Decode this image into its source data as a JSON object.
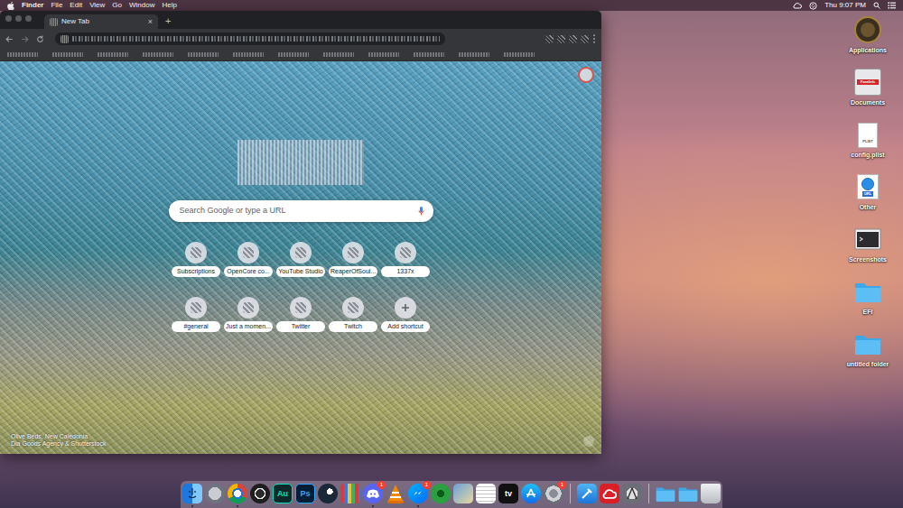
{
  "menu_bar": {
    "app_name": "Finder",
    "menus": [
      "File",
      "Edit",
      "View",
      "Go",
      "Window",
      "Help"
    ],
    "clock": "Thu 9:07 PM"
  },
  "browser": {
    "tabs": [
      {
        "label": "New Tab",
        "selected": true
      }
    ],
    "close_tab": "×",
    "new_tab": "+",
    "search": {
      "placeholder": "Search Google or type a URL"
    },
    "shortcuts": [
      {
        "label": "Subscriptions",
        "kind": "site"
      },
      {
        "label": "OpenCore co...",
        "kind": "site"
      },
      {
        "label": "YouTube Studio",
        "kind": "site"
      },
      {
        "label": "ReaperOfSoul...",
        "kind": "site"
      },
      {
        "label": "1337x",
        "kind": "site"
      },
      {
        "label": "#general",
        "kind": "site"
      },
      {
        "label": "Just a momen...",
        "kind": "site"
      },
      {
        "label": "Twitter",
        "kind": "site"
      },
      {
        "label": "Twitch",
        "kind": "site"
      },
      {
        "label": "Add shortcut",
        "kind": "add"
      }
    ],
    "credit": [
      "Olive Beds, New Caledonia",
      "Dia Goods Agency & Shutterstock"
    ]
  },
  "desktop_icons": [
    {
      "label": "Applications",
      "kind": "disk"
    },
    {
      "label": "Documents",
      "kind": "parallels",
      "glyph": "Parallels"
    },
    {
      "label": "config.plist",
      "kind": "document",
      "glyph": "PLIST"
    },
    {
      "label": "Other",
      "kind": "urldoc",
      "glyph": "URL"
    },
    {
      "label": "Screenshots",
      "kind": "screenshot"
    },
    {
      "label": "EFI",
      "kind": "folder"
    },
    {
      "label": "untitled folder",
      "kind": "folder"
    }
  ],
  "dock": [
    {
      "items": [
        {
          "kind": "finder",
          "running": true
        },
        {
          "kind": "launchpad",
          "running": false
        },
        {
          "kind": "chrome",
          "running": true
        },
        {
          "kind": "obs",
          "running": false
        },
        {
          "kind": "audition",
          "running": false,
          "glyph": "Au"
        },
        {
          "kind": "photoshop",
          "running": false,
          "glyph": "Ps"
        },
        {
          "kind": "steam",
          "running": false
        },
        {
          "kind": "books",
          "running": false
        },
        {
          "kind": "discord",
          "running": true,
          "badge": "1"
        },
        {
          "kind": "vlc",
          "running": false
        },
        {
          "kind": "messenger",
          "running": true,
          "badge": "1"
        },
        {
          "kind": "gear",
          "running": false
        },
        {
          "kind": "preview",
          "running": false
        },
        {
          "kind": "textedit",
          "running": false
        },
        {
          "kind": "appletv",
          "running": false,
          "glyph": "tv"
        },
        {
          "kind": "appstore",
          "running": false
        },
        {
          "kind": "sysprefs",
          "running": false,
          "badge": "1"
        }
      ]
    },
    {
      "items": [
        {
          "kind": "xcode",
          "running": false
        },
        {
          "kind": "creativecloud",
          "running": false
        },
        {
          "kind": "utility",
          "running": false
        }
      ]
    },
    {
      "items": [
        {
          "kind": "folder",
          "running": false
        },
        {
          "kind": "folder",
          "running": false
        },
        {
          "kind": "trash",
          "running": false
        }
      ]
    }
  ]
}
